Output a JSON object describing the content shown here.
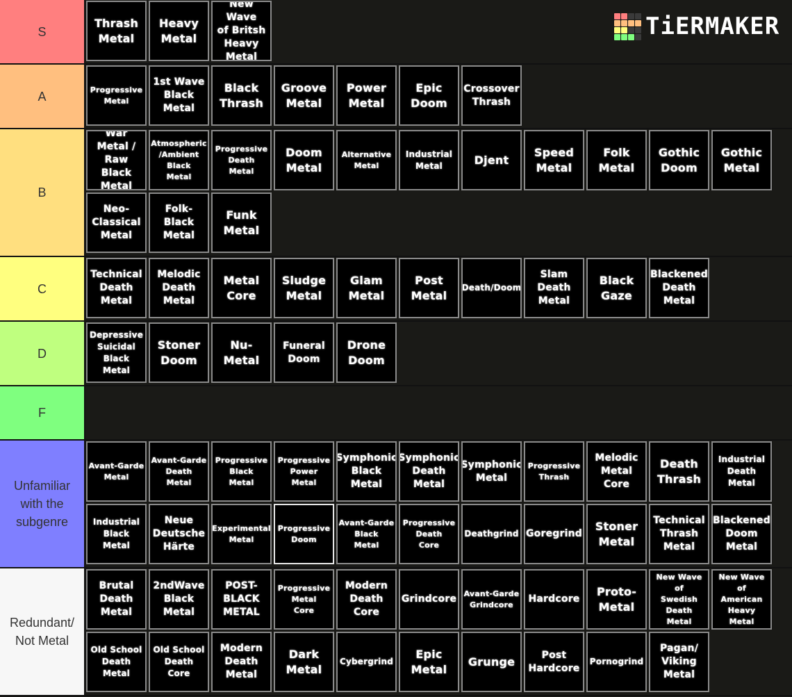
{
  "logo": {
    "text": "TiERMAKER",
    "grid_colors": [
      "#ff7f7f",
      "#ff7f7f",
      "#3a3a3a",
      "#3a3a3a",
      "#ffbf7f",
      "#ffbf7f",
      "#ffbf7f",
      "#ffbf7f",
      "#ffff7f",
      "#ffff7f",
      "#3a3a3a",
      "#3a3a3a",
      "#7fff7f",
      "#7fff7f",
      "#7fff7f",
      "#3a3a3a"
    ]
  },
  "tiers": [
    {
      "label": "S",
      "color": "#ff7f7f",
      "items": [
        "Thrash\nMetal",
        "Heavy\nMetal",
        "New Wave\nof Britsh\nHeavy\nMetal"
      ]
    },
    {
      "label": "A",
      "color": "#ffbf7f",
      "items": [
        "Progressive\nMetal",
        "1st Wave\nBlack\nMetal",
        "Black\nThrash",
        "Groove\nMetal",
        "Power\nMetal",
        "Epic\nDoom",
        "Crossover\nThrash"
      ]
    },
    {
      "label": "B",
      "color": "#ffdf7f",
      "items": [
        "War\nMetal /\nRaw Black\nMetal",
        "Atmospheric\n/Ambient\nBlack\nMetal",
        "Progressive\nDeath\nMetal",
        "Doom\nMetal",
        "Alternative\nMetal",
        "Industrial\nMetal",
        "Djent",
        "Speed\nMetal",
        "Folk\nMetal",
        "Gothic\nDoom",
        "Gothic\nMetal",
        "Neo-\nClassical\nMetal",
        "Folk-\nBlack\nMetal",
        "Funk\nMetal"
      ]
    },
    {
      "label": "C",
      "color": "#ffff7f",
      "items": [
        "Technical\nDeath\nMetal",
        "Melodic\nDeath\nMetal",
        "Metal\nCore",
        "Sludge\nMetal",
        "Glam\nMetal",
        "Post\nMetal",
        "Death/Doom",
        "Slam\nDeath\nMetal",
        "Black\nGaze",
        "Blackened\nDeath\nMetal"
      ]
    },
    {
      "label": "D",
      "color": "#bfff7f",
      "items": [
        "Depressive\nSuicidal\nBlack\nMetal",
        "Stoner\nDoom",
        "Nu-\nMetal",
        "Funeral\nDoom",
        "Drone\nDoom"
      ]
    },
    {
      "label": "F",
      "color": "#7fff7f",
      "items": []
    },
    {
      "label": "Unfamiliar with the subgenre",
      "color": "#7f7fff",
      "items": [
        "Avant-Garde\nMetal",
        "Avant-Garde\nDeath\nMetal",
        "Progressive\nBlack\nMetal",
        "Progressive\nPower\nMetal",
        "Symphonic\nBlack\nMetal",
        "Symphonic\nDeath\nMetal",
        "Symphonic\nMetal",
        "Progressive\nThrash",
        "Melodic\nMetal\nCore",
        "Death\nThrash",
        "Industrial\nDeath\nMetal",
        "Industrial\nBlack\nMetal",
        "Neue\nDeutsche\nHärte",
        "Experimental\nMetal",
        "Progressive\nDoom",
        "Avant-Garde\nBlack\nMetal",
        "Progressive\nDeath\nCore",
        "Deathgrind",
        "Goregrind",
        "Stoner\nMetal",
        "Technical\nThrash\nMetal",
        "Blackened\nDoom\nMetal"
      ]
    },
    {
      "label": "Redundant/ Not Metal",
      "color": "#f7f7f7",
      "items": [
        "Brutal\nDeath\nMetal",
        "2ndWave\nBlack\nMetal",
        "POST-\nBLACK\nMETAL",
        "Progressive\nMetal\nCore",
        "Modern\nDeath\nCore",
        "Grindcore",
        "Avant-Garde\nGrindcore",
        "Hardcore",
        "Proto-\nMetal",
        "New Wave\nof\nSwedish\nDeath\nMetal",
        "New Wave\nof\nAmerican\nHeavy\nMetal",
        "Old School\nDeath\nMetal",
        "Old School\nDeath\nCore",
        "Modern\nDeath\nMetal",
        "Dark\nMetal",
        "Cybergrind",
        "Epic\nMetal",
        "Grunge",
        "Post\nHardcore",
        "Pornogrind",
        "Pagan/\nViking\nMetal"
      ]
    }
  ]
}
